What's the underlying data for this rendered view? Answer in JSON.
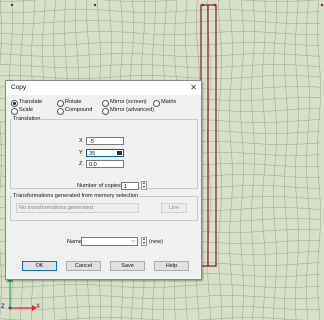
{
  "dialog": {
    "title": "Copy",
    "close_glyph": "✕",
    "options": [
      {
        "label": "Translate",
        "selected": true
      },
      {
        "label": "Rotate",
        "selected": false
      },
      {
        "label": "Mirror (screen)",
        "selected": false
      },
      {
        "label": "Matrix",
        "selected": false
      },
      {
        "label": "Scale",
        "selected": false
      },
      {
        "label": "Compound",
        "selected": false
      },
      {
        "label": "Mirror (advanced)",
        "selected": false
      }
    ],
    "translation": {
      "group_label": "Translation",
      "x_label": "X",
      "x_value": "-5",
      "y_label": "Y",
      "y_value": "35",
      "z_label": "Z",
      "z_value": "0.0"
    },
    "copies": {
      "label": "Number of copies",
      "value": "1"
    },
    "memory": {
      "group_label": "Transformations generated from memory selection",
      "list_text": "No transformations generated",
      "use_label": "Use"
    },
    "name": {
      "label": "Name",
      "value": "",
      "new_label": "(new)"
    },
    "buttons": {
      "ok": "OK",
      "cancel": "Cancel",
      "save": "Save",
      "help": "Help"
    }
  },
  "viewport": {
    "axis_x_label": "X",
    "axis_y_label": "Y",
    "axis_z_label": "Z",
    "mesh_color": "#9aa88a",
    "bg_color": "#d9e0c8",
    "highlight_color": "#7a1a2a"
  }
}
